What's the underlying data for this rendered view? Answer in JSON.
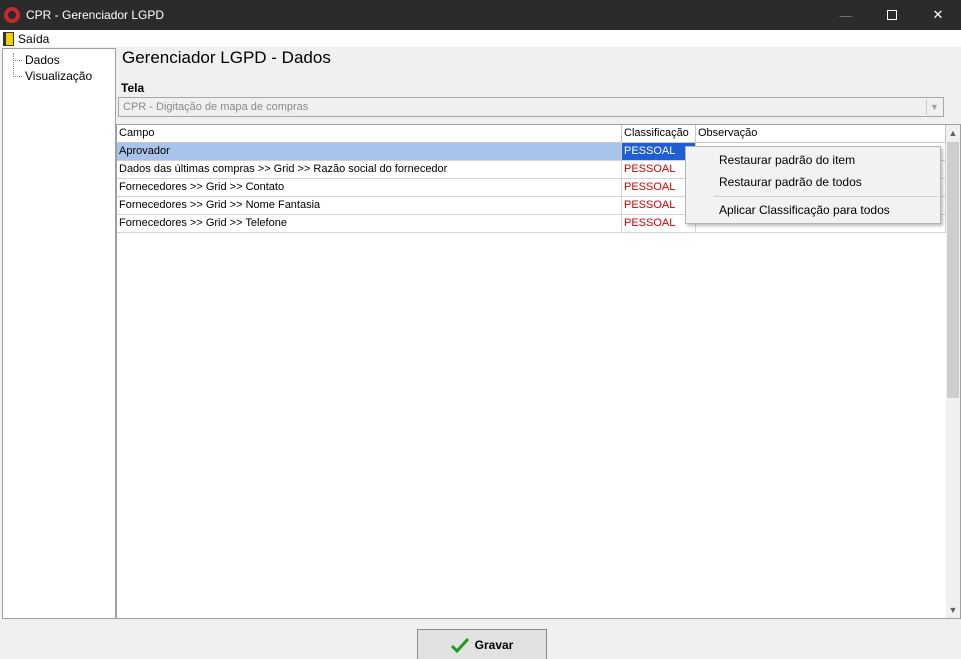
{
  "window": {
    "title": "CPR - Gerenciador LGPD",
    "minimize": "—",
    "close": "✕"
  },
  "menu": {
    "exit_label": "Saída"
  },
  "tree": {
    "items": [
      "Dados",
      "Visualização"
    ]
  },
  "main": {
    "title": "Gerenciador LGPD - Dados",
    "tela_label": "Tela",
    "tela_value": "CPR - Digitação de mapa de compras",
    "combo_arrow": "▼"
  },
  "grid": {
    "columns": [
      "Campo",
      "Classificação",
      "Observação"
    ],
    "rows": [
      {
        "campo": "Aprovador",
        "classificacao": "PESSOAL",
        "observacao": ""
      },
      {
        "campo": "Dados das últimas compras >> Grid >> Razão social do fornecedor",
        "classificacao": "PESSOAL",
        "observacao": ""
      },
      {
        "campo": "Fornecedores >> Grid >> Contato",
        "classificacao": "PESSOAL",
        "observacao": ""
      },
      {
        "campo": "Fornecedores >> Grid >> Nome Fantasia",
        "classificacao": "PESSOAL",
        "observacao": ""
      },
      {
        "campo": "Fornecedores >> Grid >> Telefone",
        "classificacao": "PESSOAL",
        "observacao": ""
      }
    ],
    "selected_row": 0,
    "scroll_up": "▲",
    "scroll_down": "▼"
  },
  "context_menu": {
    "items": [
      "Restaurar padrão do item",
      "Restaurar padrão de todos",
      "Aplicar Classificação para todos"
    ]
  },
  "footer": {
    "save_label": "Gravar"
  },
  "colors": {
    "title_bar": "#2b2b2b",
    "classification_text": "#d40000",
    "selected_row": "#a9c4ec",
    "selected_cell": "#1f5ed6",
    "check_icon": "#1e9a1e"
  },
  "icons": {
    "app": "app-logo-icon",
    "exit": "exit-door-icon",
    "save": "check-icon"
  }
}
